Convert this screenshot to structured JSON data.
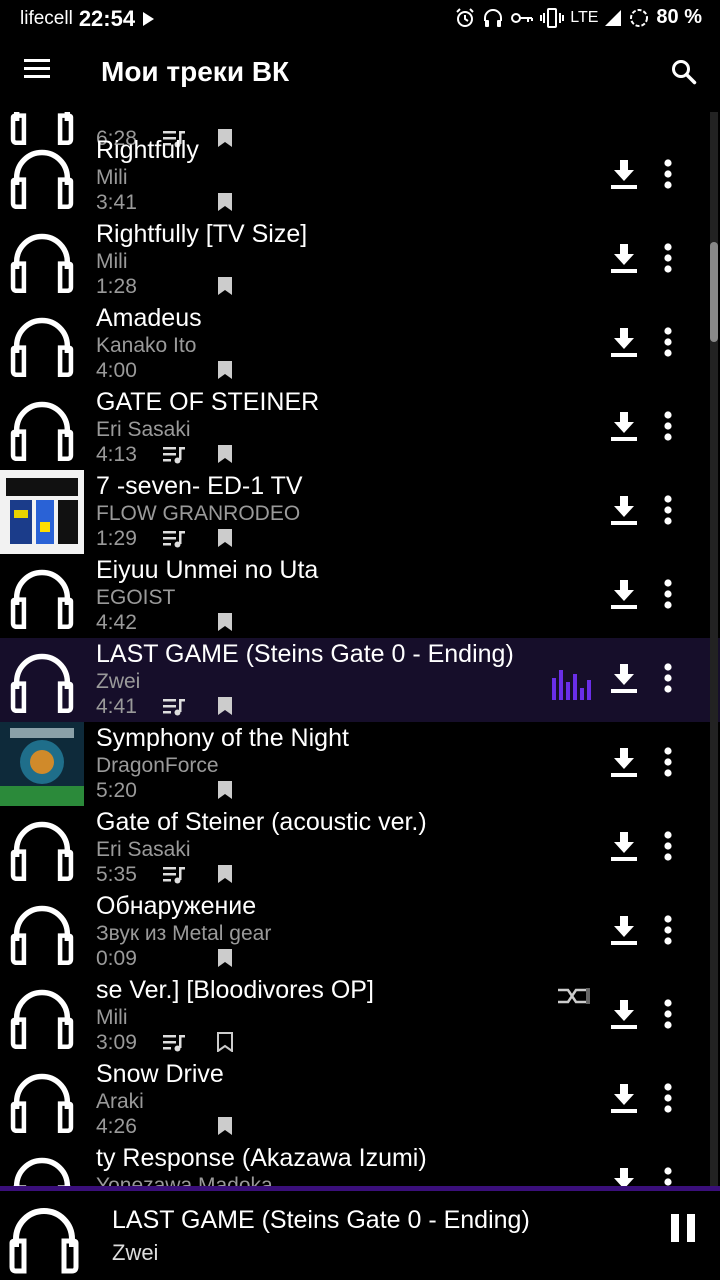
{
  "status_bar": {
    "carrier": "lifecell",
    "time": "22:54",
    "network": "LTE",
    "battery": "80 %",
    "icons": [
      "play-icon",
      "alarm-icon",
      "headset-icon",
      "key-icon",
      "vibrate-icon",
      "signal-icon",
      "sync-icon"
    ]
  },
  "app_bar": {
    "title": "Мои треки ВК",
    "menu_icon": "hamburger-menu-icon",
    "search_icon": "search-icon"
  },
  "colors": {
    "accent": "#6a2ee8",
    "current_row_bg": "#160e2a",
    "secondary_text": "#9a9a9a"
  },
  "tracks": [
    {
      "title": "",
      "artist": "",
      "duration": "6:28",
      "queue": true,
      "bookmark": "filled",
      "cover": "headphones"
    },
    {
      "title": "Rightfully",
      "artist": "Mili",
      "duration": "3:41",
      "queue": false,
      "bookmark": "filled",
      "cover": "headphones"
    },
    {
      "title": "Rightfully [TV Size]",
      "artist": "Mili",
      "duration": "1:28",
      "queue": false,
      "bookmark": "filled",
      "cover": "headphones"
    },
    {
      "title": "Amadeus",
      "artist": "Kanako Ito",
      "duration": "4:00",
      "queue": false,
      "bookmark": "filled",
      "cover": "headphones"
    },
    {
      "title": "GATE OF STEINER",
      "artist": "Eri Sasaki",
      "duration": "4:13",
      "queue": true,
      "bookmark": "filled",
      "cover": "headphones"
    },
    {
      "title": "7 -seven- ED-1 TV",
      "artist": "FLOW GRANRODEO",
      "duration": "1:29",
      "queue": true,
      "bookmark": "filled",
      "cover": "flow-album-art"
    },
    {
      "title": "Eiyuu Unmei no Uta",
      "artist": "EGOIST",
      "duration": "4:42",
      "queue": false,
      "bookmark": "filled",
      "cover": "headphones"
    },
    {
      "title": "LAST GAME (Steins Gate 0 - Ending)",
      "artist": "Zwei",
      "duration": "4:41",
      "queue": true,
      "bookmark": "filled",
      "cover": "headphones",
      "playing": true
    },
    {
      "title": "Symphony of the Night",
      "artist": "DragonForce",
      "duration": "5:20",
      "queue": false,
      "bookmark": "filled",
      "cover": "dragonforce-album-art"
    },
    {
      "title": "Gate of Steiner (acoustic ver.)",
      "artist": "Eri Sasaki",
      "duration": "5:35",
      "queue": true,
      "bookmark": "filled",
      "cover": "headphones"
    },
    {
      "title": "Обнаружение",
      "artist": "Звук из Metal gear",
      "duration": "0:09",
      "queue": false,
      "bookmark": "filled",
      "cover": "headphones"
    },
    {
      "title": "se Ver.] [Bloodivores OP]",
      "artist": "Mili",
      "duration": "3:09",
      "queue": true,
      "bookmark": "outline",
      "cover": "headphones",
      "shuffle_badge": true
    },
    {
      "title": "Snow Drive",
      "artist": "Araki",
      "duration": "4:26",
      "queue": false,
      "bookmark": "filled",
      "cover": "headphones"
    },
    {
      "title": "ty Response (Akazawa Izumi)",
      "artist": "Yonezawa Madoka",
      "duration": "",
      "queue": false,
      "bookmark": "none",
      "cover": "headphones"
    }
  ],
  "mini_player": {
    "title": "LAST GAME (Steins Gate 0 - Ending)",
    "artist": "Zwei",
    "progress": 0.0,
    "pause_icon": "pause-icon"
  }
}
